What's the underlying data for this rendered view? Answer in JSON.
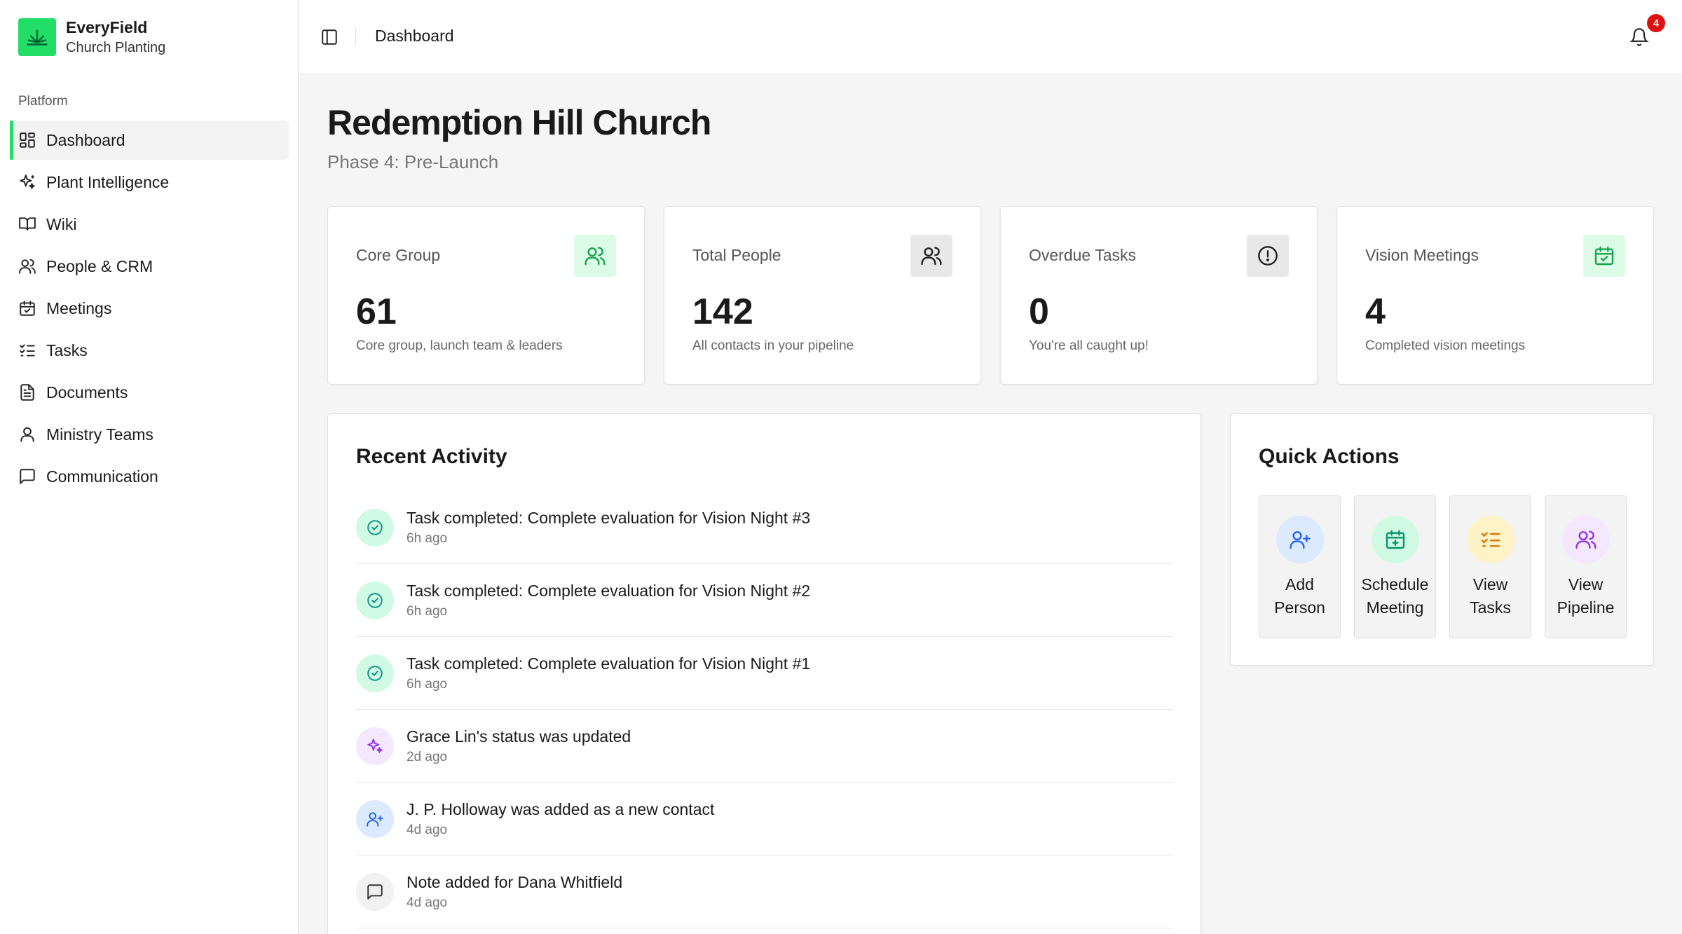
{
  "brand": {
    "name": "EveryField",
    "subtitle": "Church Planting"
  },
  "sidebar": {
    "section_label": "Platform",
    "items": [
      {
        "label": "Dashboard",
        "icon": "dashboard-grid-icon",
        "active": true
      },
      {
        "label": "Plant Intelligence",
        "icon": "sparkles-icon"
      },
      {
        "label": "Wiki",
        "icon": "book-open-icon"
      },
      {
        "label": "People & CRM",
        "icon": "users-icon"
      },
      {
        "label": "Meetings",
        "icon": "calendar-icon"
      },
      {
        "label": "Tasks",
        "icon": "list-checks-icon"
      },
      {
        "label": "Documents",
        "icon": "document-icon"
      },
      {
        "label": "Ministry Teams",
        "icon": "user-icon"
      },
      {
        "label": "Communication",
        "icon": "message-square-icon"
      }
    ]
  },
  "topbar": {
    "title": "Dashboard",
    "notification_count": "4"
  },
  "page": {
    "title": "Redemption Hill Church",
    "subtitle": "Phase 4: Pre-Launch"
  },
  "stats": [
    {
      "label": "Core Group",
      "value": "61",
      "desc": "Core group, launch team & leaders",
      "icon": "users-icon"
    },
    {
      "label": "Total People",
      "value": "142",
      "desc": "All contacts in your pipeline",
      "icon": "users-icon"
    },
    {
      "label": "Overdue Tasks",
      "value": "0",
      "desc": "You're all caught up!",
      "icon": "alert-circle-icon"
    },
    {
      "label": "Vision Meetings",
      "value": "4",
      "desc": "Completed vision meetings",
      "icon": "calendar-check-icon"
    }
  ],
  "activity": {
    "title": "Recent Activity",
    "items": [
      {
        "title": "Task completed: Complete evaluation for Vision Night #3",
        "time": "6h ago",
        "icon": "check-circle-icon"
      },
      {
        "title": "Task completed: Complete evaluation for Vision Night #2",
        "time": "6h ago",
        "icon": "check-circle-icon"
      },
      {
        "title": "Task completed: Complete evaluation for Vision Night #1",
        "time": "6h ago",
        "icon": "check-circle-icon"
      },
      {
        "title": "Grace Lin's status was updated",
        "time": "2d ago",
        "icon": "sparkles-icon"
      },
      {
        "title": "J. P. Holloway was added as a new contact",
        "time": "4d ago",
        "icon": "user-plus-icon"
      },
      {
        "title": "Note added for Dana Whitfield",
        "time": "4d ago",
        "icon": "message-square-icon"
      }
    ]
  },
  "quick_actions": {
    "title": "Quick Actions",
    "items": [
      {
        "line1": "Add",
        "line2": "Person",
        "icon": "user-plus-icon"
      },
      {
        "line1": "Schedule",
        "line2": "Meeting",
        "icon": "calendar-plus-icon"
      },
      {
        "line1": "View",
        "line2": "Tasks",
        "icon": "list-checks-icon"
      },
      {
        "line1": "View",
        "line2": "Pipeline",
        "icon": "users-icon"
      }
    ]
  },
  "colors": {
    "accent": "#22dd66",
    "badge": "#dd1111"
  }
}
